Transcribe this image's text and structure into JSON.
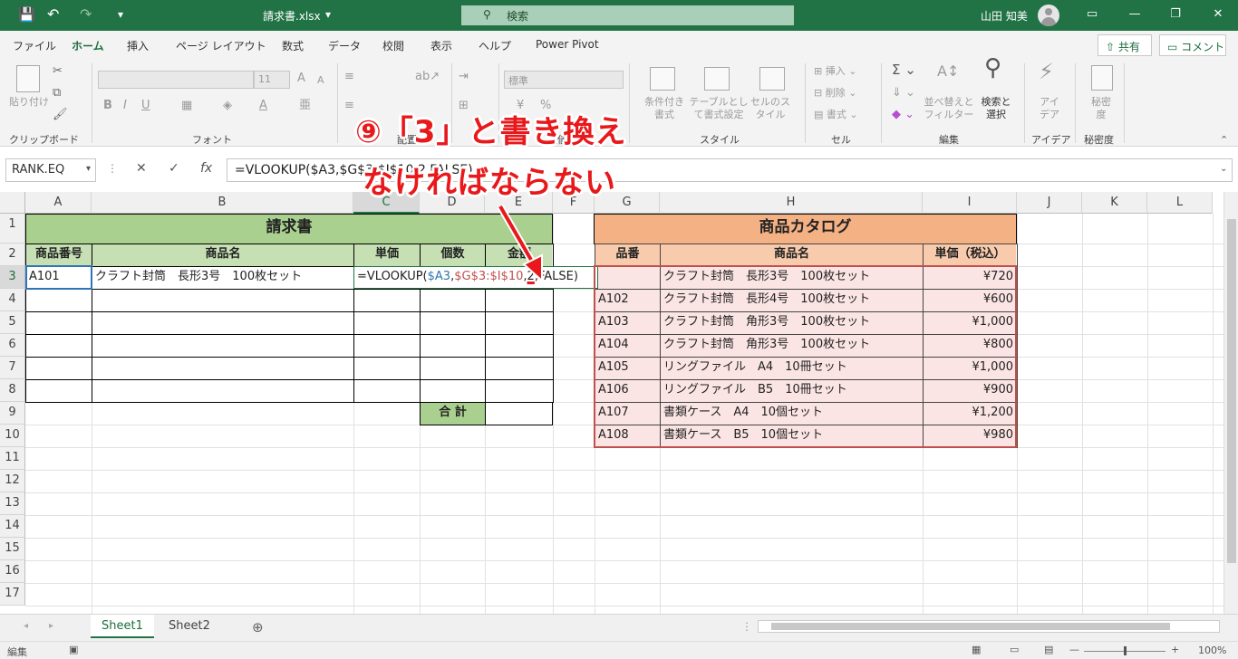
{
  "titlebar": {
    "filename": "請求書.xlsx",
    "filename_caret": "▾",
    "search_placeholder": "検索",
    "user_name": "山田 知美",
    "qat_save": "💾",
    "qat_undo": "↶",
    "qat_redo": "↷",
    "qat_more": "▾",
    "win_display": "▭",
    "win_min": "—",
    "win_max": "❐",
    "win_close": "✕"
  },
  "menu": {
    "items": [
      "ファイル",
      "ホーム",
      "挿入",
      "ページ レイアウト",
      "数式",
      "データ",
      "校閲",
      "表示",
      "ヘルプ",
      "Power Pivot"
    ],
    "share": "共有",
    "comment": "コメント"
  },
  "ribbon": {
    "paste": "貼り付け",
    "clipboard": "クリップボード",
    "font_size": "11",
    "font": "フォント",
    "align": "配置",
    "number_format": "標準",
    "number": "数値",
    "cond_format": "条件付き書式",
    "table_format": "テーブルとして書式設定",
    "cell_style": "セルのスタイル",
    "style": "スタイル",
    "insert": "挿入",
    "delete": "削除",
    "format": "書式",
    "cells": "セル",
    "sort_filter": "並べ替えとフィルター",
    "find_select": "検索と選択",
    "edit": "編集",
    "ideas": "アイデア",
    "ideas_group": "アイデア",
    "sensitivity": "秘密度",
    "sensitivity_group": "秘密度"
  },
  "formula_bar": {
    "name_box": "RANK.EQ",
    "cancel": "✕",
    "enter": "✓",
    "fx": "fx",
    "formula": "=VLOOKUP($A3,$G$3:$I$10,2,FALSE)"
  },
  "columns": [
    "A",
    "B",
    "C",
    "D",
    "E",
    "F",
    "G",
    "H",
    "I",
    "J",
    "K",
    "L"
  ],
  "rows": [
    "1",
    "2",
    "3",
    "4",
    "5",
    "6",
    "7",
    "8",
    "9",
    "10",
    "11",
    "12",
    "13",
    "14",
    "15",
    "16",
    "17"
  ],
  "invoice": {
    "title": "請求書",
    "headers": [
      "商品番号",
      "商品名",
      "単価",
      "個数",
      "金額"
    ],
    "row3_code": "A101",
    "row3_name": "クラフト封筒　長形3号　100枚セット",
    "row3_formula_parts": [
      "=VLOOKUP(",
      "$A3",
      ",",
      "$G$3:$I$10",
      ",",
      "2",
      ",FALSE)"
    ],
    "total_label": "合 計"
  },
  "catalog": {
    "title": "商品カタログ",
    "headers": [
      "品番",
      "商品名",
      "単価（税込）"
    ],
    "rows": [
      {
        "code": "",
        "name": "クラフト封筒　長形3号　100枚セット",
        "price": "¥720"
      },
      {
        "code": "A102",
        "name": "クラフト封筒　長形4号　100枚セット",
        "price": "¥600"
      },
      {
        "code": "A103",
        "name": "クラフト封筒　角形3号　100枚セット",
        "price": "¥1,000"
      },
      {
        "code": "A104",
        "name": "クラフト封筒　角形3号　100枚セット",
        "price": "¥800"
      },
      {
        "code": "A105",
        "name": "リングファイル　A4　10冊セット",
        "price": "¥1,000"
      },
      {
        "code": "A106",
        "name": "リングファイル　B5　10冊セット",
        "price": "¥900"
      },
      {
        "code": "A107",
        "name": "書類ケース　A4　10個セット",
        "price": "¥1,200"
      },
      {
        "code": "A108",
        "name": "書類ケース　B5　10個セット",
        "price": "¥980"
      }
    ]
  },
  "annotation": {
    "line1": "⑨「3」と書き換え",
    "line2": "なければならない"
  },
  "tabs": [
    "Sheet1",
    "Sheet2"
  ],
  "tab_add": "⊕",
  "status": {
    "mode": "編集",
    "zoom": "100%",
    "zoom_minus": "—",
    "zoom_plus": "+"
  },
  "colors": {
    "excel_green": "#217346",
    "invoice_header": "#a9d08e",
    "invoice_subheader": "#c6e0b4",
    "catalog_header": "#f4b183",
    "catalog_subheader": "#f8cbad",
    "catalog_body": "#fbe5e4",
    "annotation_red": "#e8181b",
    "ref_blue": "#2e75b6",
    "ref_red": "#c0504d"
  }
}
